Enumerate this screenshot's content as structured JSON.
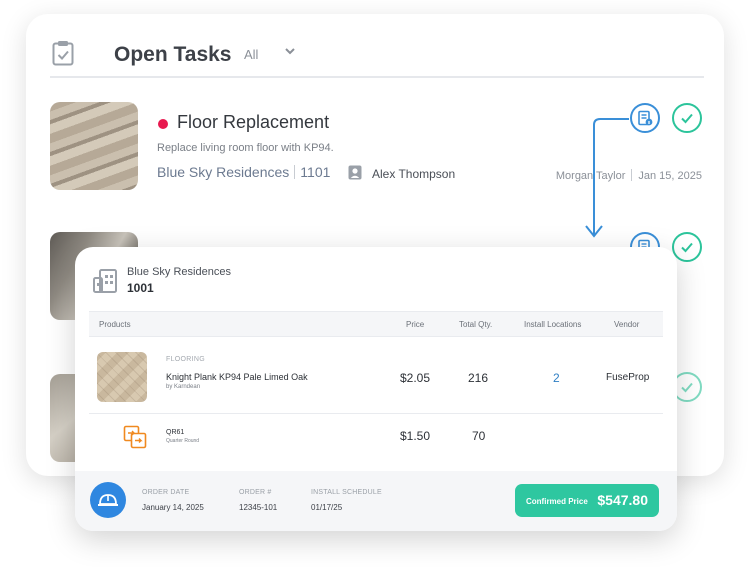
{
  "back_card": {
    "title": "Open Tasks",
    "filter": "All",
    "tasks": [
      {
        "title": "Floor Replacement",
        "description": "Replace living room floor with KP94.",
        "property": "Blue Sky Residences",
        "unit": "1101",
        "assignee": "Alex Thompson",
        "creator": "Morgan Taylor",
        "date": "Jan 15, 2025",
        "status_color": "#e8194f"
      }
    ]
  },
  "order": {
    "property": "Blue Sky Residences",
    "unit": "1001",
    "columns": {
      "products": "Products",
      "price": "Price",
      "total_qty": "Total Qty.",
      "install_locations": "Install Locations",
      "vendor": "Vendor"
    },
    "rows": [
      {
        "category": "FLOORING",
        "name": "Knight Plank KP94 Pale Limed Oak",
        "brand": "by Karndean",
        "price": "$2.05",
        "qty": "216",
        "install_locations": "2",
        "vendor": "FuseProp"
      },
      {
        "code": "QR61",
        "description": "Quarter Round",
        "price": "$1.50",
        "qty": "70"
      }
    ],
    "footer": {
      "order_date_label": "ORDER DATE",
      "order_date": "January 14, 2025",
      "order_num_label": "ORDER #",
      "order_num": "12345-101",
      "install_schedule_label": "INSTALL SCHEDULE",
      "install_schedule": "01/17/25",
      "confirmed_price_label": "Confirmed Price",
      "confirmed_price": "$547.80"
    }
  },
  "colors": {
    "accent_blue": "#3a8fd8",
    "accent_green": "#2cc49b",
    "confirmed_green": "#2ec7a0"
  }
}
